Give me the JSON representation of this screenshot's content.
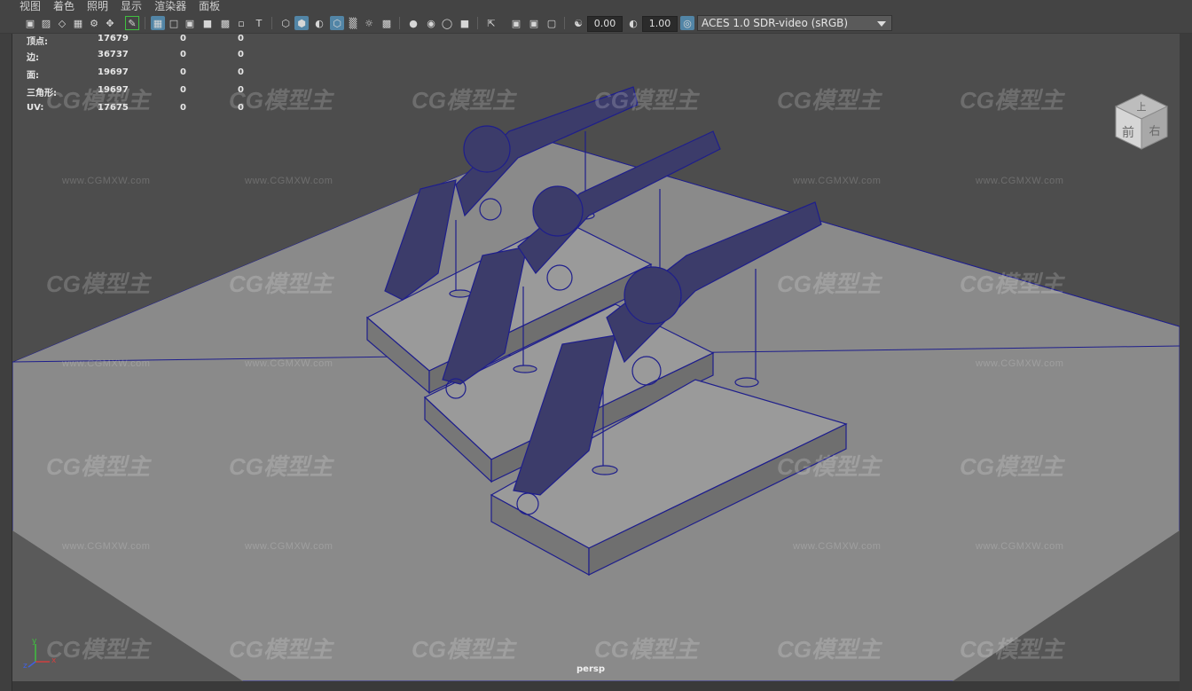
{
  "menu": [
    "视图",
    "着色",
    "照明",
    "显示",
    "渲染器",
    "面板"
  ],
  "toolbar": {
    "exposure_value": "0.00",
    "gamma_value": "1.00",
    "color_management": "ACES 1.0 SDR-video (sRGB)"
  },
  "hud_stats": [
    {
      "label": "顶点:",
      "v1": "17679",
      "v2": "0",
      "v3": "0"
    },
    {
      "label": "边:",
      "v1": "36737",
      "v2": "0",
      "v3": "0"
    },
    {
      "label": "面:",
      "v1": "19697",
      "v2": "0",
      "v3": "0"
    },
    {
      "label": "三角形:",
      "v1": "19697",
      "v2": "0",
      "v3": "0"
    },
    {
      "label": "UV:",
      "v1": "17675",
      "v2": "0",
      "v3": "0"
    }
  ],
  "camera_label": "persp",
  "viewcube": {
    "top": "上",
    "front": "前",
    "right": "右"
  },
  "axis": {
    "x": "x",
    "y": "y",
    "z": "z"
  },
  "watermark": {
    "logo": "CG模型主",
    "url": "www.CGMXW.com"
  },
  "colors": {
    "wireframe": "#1e1e8c",
    "floor": "#8e8e8e",
    "viewport_bg": "#4d4d4d",
    "highlight": "#5285a6"
  }
}
